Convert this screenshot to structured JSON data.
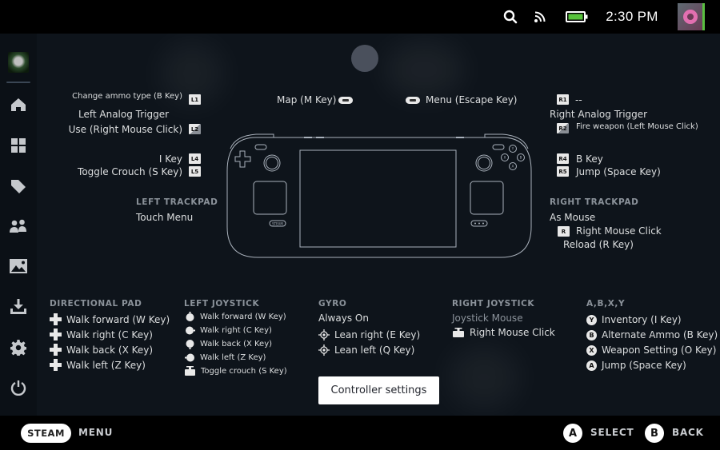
{
  "status_bar": {
    "time": "2:30 PM",
    "icons": [
      "search-icon",
      "wifi-icon",
      "battery-icon",
      "user-avatar"
    ],
    "battery_color": "#58c33c"
  },
  "sidebar": {
    "items": [
      {
        "name": "game-avatar",
        "icon": "game-avatar"
      },
      {
        "name": "home",
        "icon": "home-icon"
      },
      {
        "name": "library",
        "icon": "grid-icon"
      },
      {
        "name": "store",
        "icon": "tag-icon"
      },
      {
        "name": "friends",
        "icon": "friends-icon"
      },
      {
        "name": "media",
        "icon": "image-icon"
      },
      {
        "name": "downloads",
        "icon": "download-icon"
      },
      {
        "name": "settings",
        "icon": "gear-icon"
      },
      {
        "name": "power",
        "icon": "power-icon"
      }
    ]
  },
  "left_shoulder": {
    "l1": {
      "key": "L1",
      "action": "Change ammo type (B Key)"
    },
    "l2_header": "Left Analog Trigger",
    "l2": {
      "key": "L2",
      "action": "Use (Right Mouse Click)"
    },
    "l4": {
      "key": "L4",
      "action": "I Key"
    },
    "l5": {
      "key": "L5",
      "action": "Toggle Crouch (S Key)"
    }
  },
  "center_top": {
    "view": {
      "action": "Map (M Key)",
      "icon": "view-button-icon"
    },
    "menu": {
      "action": "Menu (Escape Key)",
      "icon": "menu-button-icon"
    }
  },
  "right_shoulder": {
    "r1": {
      "key": "R1",
      "action": "--"
    },
    "r2_header": "Right Analog Trigger",
    "r2": {
      "key": "R2",
      "action": "Fire weapon (Left Mouse Click)"
    },
    "r4": {
      "key": "R4",
      "action": "B Key"
    },
    "r5": {
      "key": "R5",
      "action": "Jump (Space Key)"
    }
  },
  "left_trackpad": {
    "title": "LEFT TRACKPAD",
    "mode": "Touch Menu"
  },
  "right_trackpad": {
    "title": "RIGHT TRACKPAD",
    "mode": "As Mouse",
    "bindings": [
      {
        "key": "R",
        "action": "Right Mouse Click"
      },
      {
        "action": "Reload (R Key)"
      }
    ]
  },
  "directional_pad": {
    "title": "DIRECTIONAL PAD",
    "items": [
      "Walk forward (W Key)",
      "Walk right (C Key)",
      "Walk back (X Key)",
      "Walk left (Z Key)"
    ]
  },
  "left_joystick": {
    "title": "LEFT JOYSTICK",
    "items": [
      "Walk forward (W Key)",
      "Walk right (C Key)",
      "Walk back (X Key)",
      "Walk left (Z Key)",
      "Toggle crouch (S Key)"
    ]
  },
  "gyro": {
    "title": "GYRO",
    "mode": "Always On",
    "items": [
      "Lean right (E Key)",
      "Lean left (Q Key)"
    ]
  },
  "right_joystick": {
    "title": "RIGHT JOYSTICK",
    "mode": "Joystick Mouse",
    "items": [
      "Right Mouse Click"
    ]
  },
  "face_buttons": {
    "title": "A,B,X,Y",
    "items": [
      {
        "button": "Y",
        "action": "Inventory (I Key)"
      },
      {
        "button": "B",
        "action": "Alternate Ammo (B Key)"
      },
      {
        "button": "X",
        "action": "Weapon Setting (O Key)"
      },
      {
        "button": "A",
        "action": "Jump (Space Key)"
      }
    ]
  },
  "controller_settings_label": "Controller settings",
  "device": {
    "steam_label": "STEAM"
  },
  "footer": {
    "steam_label": "STEAM",
    "menu_label": "MENU",
    "select_button": "A",
    "select_label": "SELECT",
    "back_button": "B",
    "back_label": "BACK"
  }
}
